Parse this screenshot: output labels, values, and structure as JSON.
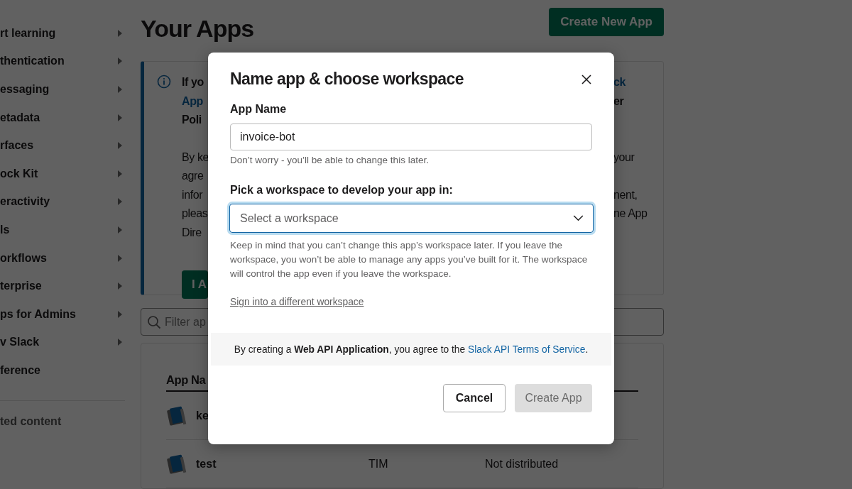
{
  "sidebar": {
    "items": [
      {
        "label": "rt learning",
        "expandable": true
      },
      {
        "label": "thentication",
        "expandable": true
      },
      {
        "label": "essaging",
        "expandable": true
      },
      {
        "label": "etadata",
        "expandable": true
      },
      {
        "label": "rfaces",
        "expandable": true
      },
      {
        "label": "ock Kit",
        "expandable": true
      },
      {
        "label": "eractivity",
        "expandable": true
      },
      {
        "label": "ls",
        "expandable": true
      },
      {
        "label": "orkflows",
        "expandable": true
      },
      {
        "label": "terprise",
        "expandable": true
      },
      {
        "label": "ps for Admins",
        "expandable": true
      },
      {
        "label": "v Slack",
        "expandable": true
      },
      {
        "label": "ference",
        "expandable": false
      }
    ],
    "footer": "ted content"
  },
  "page": {
    "title": "Your Apps",
    "create_button": "Create New App"
  },
  "notice": {
    "paragraphs": [
      {
        "lines": [
          {
            "left": {
              "text": "If yo",
              "kind": "bold"
            },
            "right": {
              "text": "ck",
              "kind": "link"
            }
          },
          {
            "left": {
              "text": "App",
              "kind": "link"
            },
            "right": {
              "text": "er",
              "kind": "bold"
            }
          },
          {
            "left": {
              "text": "Poli",
              "kind": "bold"
            }
          }
        ]
      },
      {
        "lines": [
          {
            "left": {
              "text": "By ke",
              "kind": "normal"
            },
            "right": {
              "text": "your",
              "kind": "normal"
            }
          },
          {
            "left": {
              "text": "agre",
              "kind": "normal"
            }
          },
          {
            "left": {
              "text": "infor",
              "kind": "normal"
            },
            "right": {
              "text": "nent,",
              "kind": "normal"
            }
          },
          {
            "left": {
              "text": "pleas",
              "kind": "normal"
            },
            "right": {
              "text": "ne App",
              "kind": "normal"
            }
          },
          {
            "left": {
              "text": "Dire",
              "kind": "normal"
            }
          }
        ]
      }
    ],
    "button": "I A"
  },
  "filter": {
    "placeholder": "Filter ap"
  },
  "table": {
    "columns": [
      "App Na"
    ],
    "rows": [
      {
        "name": "ke"
      },
      {
        "name": "test",
        "column_2": "TIM",
        "column_3": "Not distributed"
      }
    ]
  },
  "modal": {
    "title": "Name app & choose workspace",
    "app_name": {
      "label": "App Name",
      "value": "invoice-bot",
      "hint": "Don’t worry - you’ll be able to change this later."
    },
    "workspace": {
      "label": "Pick a workspace to develop your app in:",
      "placeholder": "Select a workspace",
      "focused": true,
      "help": "Keep in mind that you can’t change this app’s workspace later. If you leave the workspace, you won’t be able to manage any apps you’ve built for it. The workspace will control the app even if you leave the workspace."
    },
    "link": "Sign into a different workspace",
    "terms": {
      "before": "By creating a **Web API Application**, you agree to the ",
      "link": "Slack API Terms of Service",
      "after": "."
    },
    "buttons": [
      {
        "label": "Cancel",
        "kind": "secondary",
        "disabled": false
      },
      {
        "label": "Create App",
        "kind": "primary",
        "disabled": true
      }
    ]
  }
}
